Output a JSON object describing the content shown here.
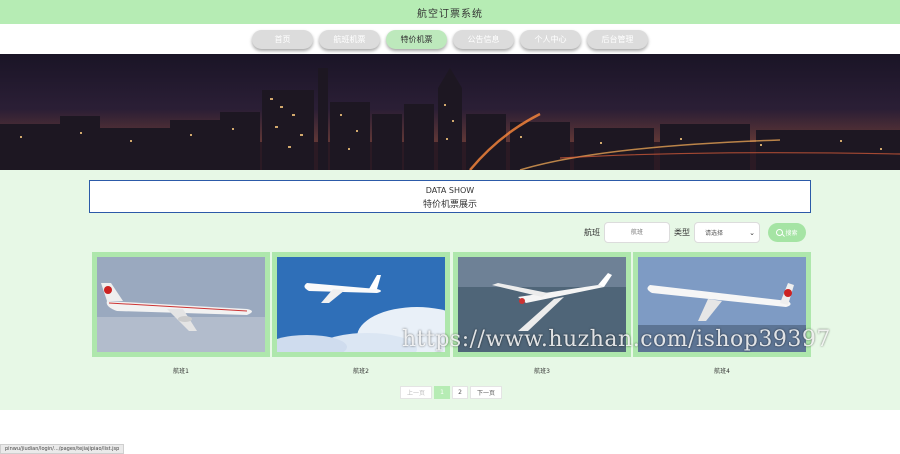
{
  "app": {
    "title": "航空订票系统"
  },
  "nav": {
    "items": [
      {
        "label": "首页",
        "active": false
      },
      {
        "label": "航班机票",
        "active": false
      },
      {
        "label": "特价机票",
        "active": true
      },
      {
        "label": "公告信息",
        "active": false
      },
      {
        "label": "个人中心",
        "active": false
      },
      {
        "label": "后台管理",
        "active": false
      }
    ]
  },
  "section": {
    "title_en": "DATA SHOW",
    "title_cn": "特价机票展示"
  },
  "search": {
    "flight_label": "航班",
    "flight_placeholder": "航班",
    "type_label": "类型",
    "type_value": "请选择",
    "button_label": "搜索"
  },
  "cards": [
    {
      "label": "航班1"
    },
    {
      "label": "航班2"
    },
    {
      "label": "航班3"
    },
    {
      "label": "航班4"
    }
  ],
  "pagination": {
    "prev": "上一页",
    "pages": [
      "1",
      "2"
    ],
    "current": "1",
    "next": "下一页"
  },
  "watermark": "https://www.huzhan.com/ishop39397",
  "status_bar": "pinwu/jiudian/login/.../pages/tejiajipiao/list.jsp",
  "colors": {
    "accent_green": "#b6ecb4",
    "content_bg": "#e7f8e6",
    "border_blue": "#2c5aa8"
  },
  "icons": {
    "search_button": "search-icon",
    "select": "chevron-down-icon"
  }
}
